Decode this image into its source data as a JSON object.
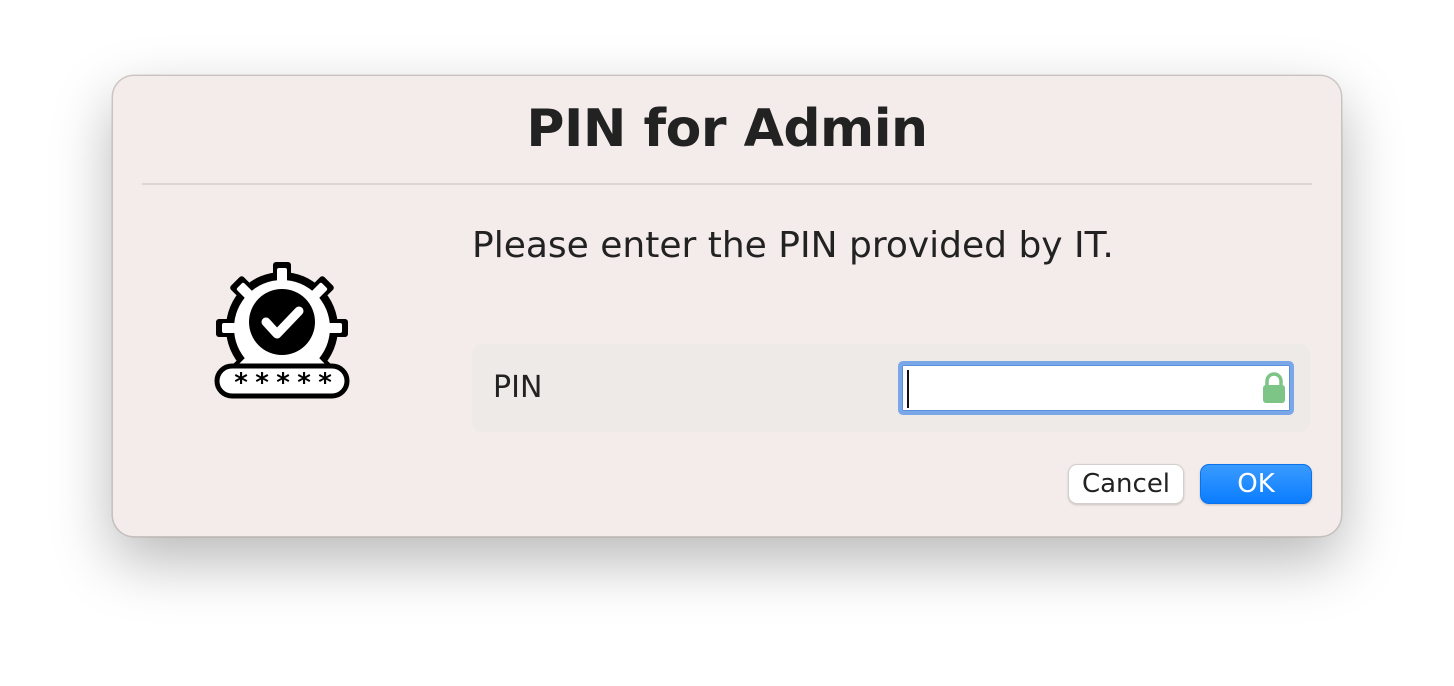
{
  "dialog": {
    "title": "PIN for Admin",
    "message": "Please enter the PIN provided by IT.",
    "icon": "gear-badge-checkmark-password-icon"
  },
  "form": {
    "pin_label": "PIN",
    "pin_value": "",
    "pin_field_type": "password",
    "secure_field_icon": "lock-icon"
  },
  "buttons": {
    "cancel_label": "Cancel",
    "ok_label": "OK"
  },
  "colors": {
    "dialog_background": "#f4ecea",
    "accent_blue": "#0a7dff",
    "focus_ring": "#7aa7e8",
    "lock_green": "#7dc487"
  }
}
